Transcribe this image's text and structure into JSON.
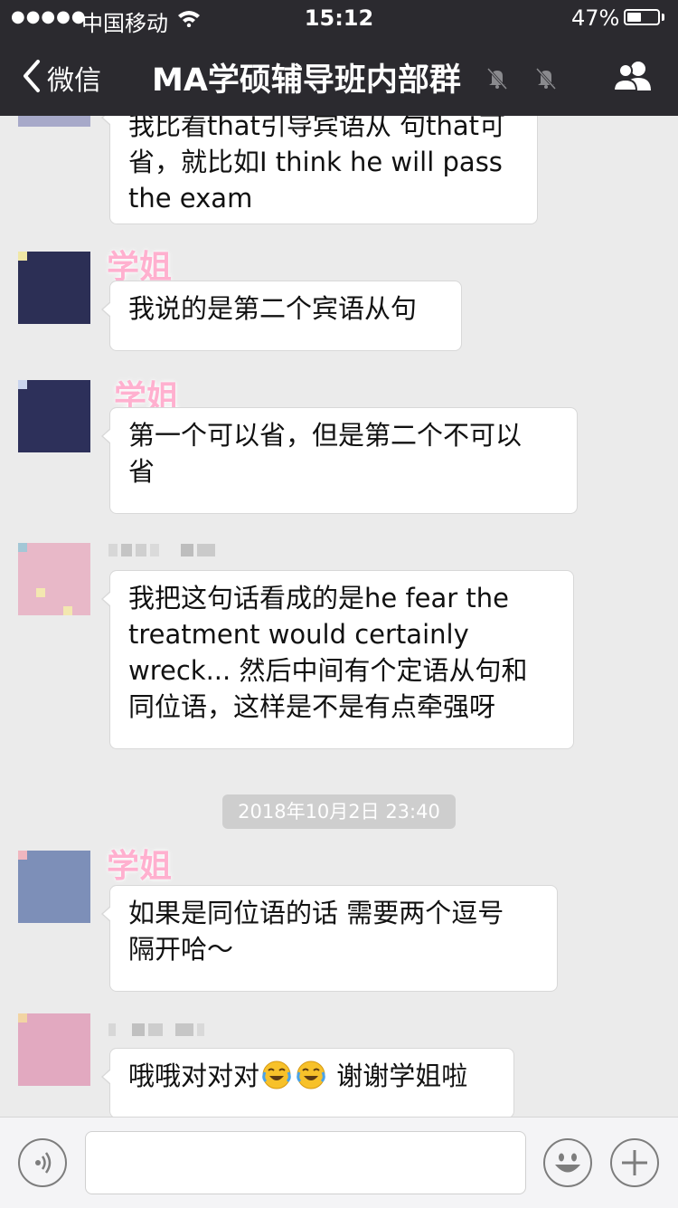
{
  "status_bar": {
    "signal": "●●●●●",
    "carrier": "中国移动",
    "time": "15:12",
    "battery_pct": "47%",
    "battery_level": 0.47
  },
  "nav": {
    "back_label": "微信",
    "title": "MA学硕辅导班内部群"
  },
  "messages": [
    {
      "sender": "",
      "lines": [
        "我比看that引导宾语从 句that可",
        "省，就比如I think he will pass",
        "the exam"
      ]
    },
    {
      "sender": "学姐",
      "lines": [
        "我说的是第二个宾语从句"
      ]
    },
    {
      "sender": "学姐",
      "lines": [
        "第一个可以省，但是第二个不可以",
        "省"
      ]
    },
    {
      "sender": "",
      "lines": [
        "我把这句话看成的是he fear the",
        "treatment would certainly",
        "wreck... 然后中间有个定语从句和",
        "同位语，这样是不是有点牵强呀"
      ]
    },
    {
      "sender": "学姐",
      "lines": [
        "如果是同位语的话 需要两个逗号",
        "隔开哈～"
      ]
    },
    {
      "sender": "",
      "text_before": "哦哦对对对",
      "emoji": [
        "face-with-tears-of-joy-icon",
        "face-with-tears-of-joy-icon"
      ],
      "text_after": " 谢谢学姐啦"
    }
  ],
  "timestamp": "2018年10月2日 23:40",
  "colors": {
    "nav_bg": "#2b2a2f",
    "chat_bg": "#ebebeb",
    "sender_name": "#ffb0cf",
    "timestamp_bg": "#cecece"
  }
}
